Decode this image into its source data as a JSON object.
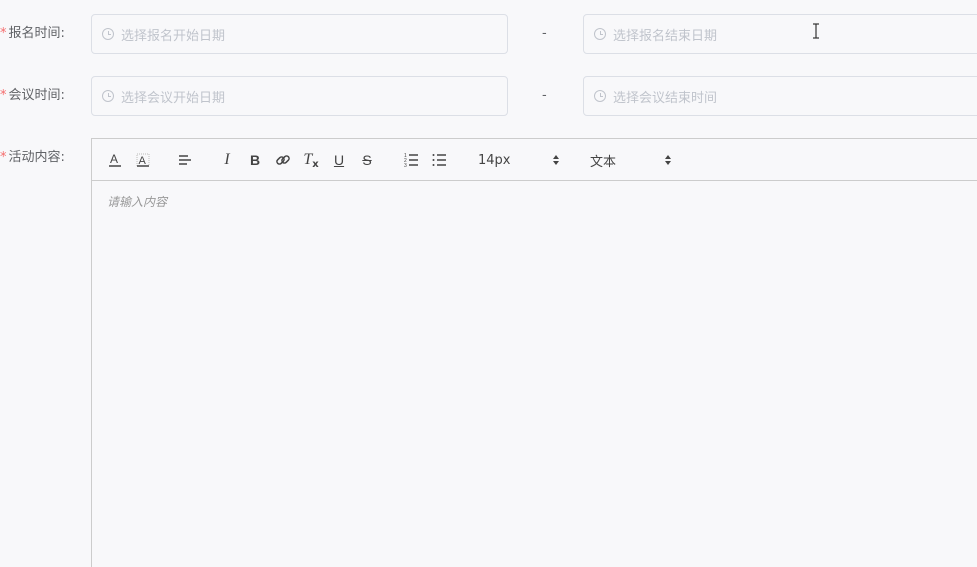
{
  "form": {
    "signup": {
      "required_mark": "*",
      "label": "报名时间:",
      "start_placeholder": "选择报名开始日期",
      "separator": "-",
      "end_placeholder": "选择报名结束日期"
    },
    "meeting": {
      "required_mark": "*",
      "label": "会议时间:",
      "start_placeholder": "选择会议开始日期",
      "separator": "-",
      "end_placeholder": "选择会议结束时间"
    },
    "content": {
      "required_mark": "*",
      "label": "活动内容:"
    }
  },
  "editor": {
    "toolbar": {
      "font_color_icon": "font-color-icon",
      "background_color_icon": "background-color-icon",
      "align_icon": "align-left-icon",
      "italic_label": "I",
      "bold_label": "B",
      "link_icon": "link-icon",
      "clean_label": "T",
      "underline_label": "U",
      "strike_label": "S",
      "ordered_list_icon": "ordered-list-icon",
      "bullet_list_icon": "bullet-list-icon",
      "size_value": "14px",
      "header_value": "文本"
    },
    "placeholder": "请输入内容"
  },
  "colors": {
    "required": "#f56c6c",
    "border": "#dcdfe6",
    "placeholder": "#c0c4cc",
    "background": "#f8f8fa"
  }
}
